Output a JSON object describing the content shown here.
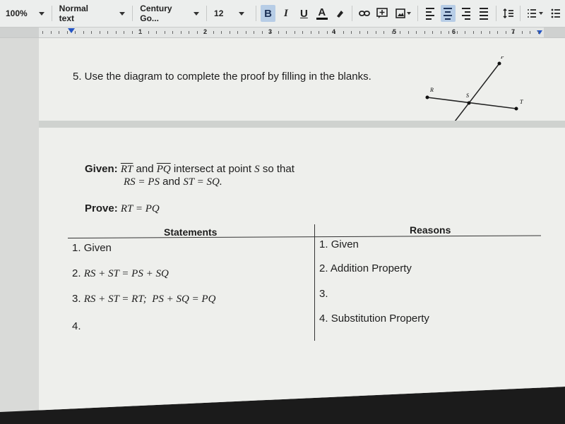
{
  "toolbar": {
    "zoom": "100%",
    "style": "Normal text",
    "font": "Century Go...",
    "font_size": "12",
    "bold": "B",
    "italic": "I",
    "underline": "U",
    "text_color": "A",
    "active_alignment": "center",
    "icons": [
      "bold-icon",
      "italic-icon",
      "underline-icon",
      "text-color-icon",
      "highlight-icon",
      "link-icon",
      "comment-icon",
      "image-icon",
      "align-left-icon",
      "align-center-icon",
      "align-right-icon",
      "justify-icon",
      "line-spacing-icon",
      "numbered-list-icon",
      "bulleted-list-icon"
    ]
  },
  "ruler": {
    "numbers": [
      "1",
      "2",
      "3",
      "4",
      "5",
      "6",
      "7"
    ]
  },
  "question": {
    "text": "5. Use the diagram to complete the proof by filling in the blanks."
  },
  "diagram": {
    "points": {
      "R": "R",
      "S": "S",
      "T": "T",
      "P": "P"
    }
  },
  "proof": {
    "given_label": "Given:",
    "given_seg1": "RT",
    "given_and": "and",
    "given_seg2": "PQ",
    "given_rest": "intersect at point",
    "given_point": "S",
    "given_sothat": "so that",
    "given_eq1": "RS = PS",
    "given_and2": "and",
    "given_eq2": "ST = SQ.",
    "prove_label": "Prove:",
    "prove_eq": "RT = PQ",
    "statements_header": "Statements",
    "reasons_header": "Reasons",
    "statements": [
      {
        "num": "1.",
        "text": "Given",
        "math": false
      },
      {
        "num": "2.",
        "text": "RS + ST = PS + SQ",
        "math": true
      },
      {
        "num": "3.",
        "text": "RS + ST = RT;  PS + SQ = PQ",
        "math": true
      },
      {
        "num": "4.",
        "text": "",
        "math": true
      }
    ],
    "reasons": [
      {
        "num": "1.",
        "text": "Given"
      },
      {
        "num": "2.",
        "text": "Addition Property"
      },
      {
        "num": "3.",
        "text": ""
      },
      {
        "num": "4.",
        "text": "Substitution Property"
      }
    ]
  }
}
